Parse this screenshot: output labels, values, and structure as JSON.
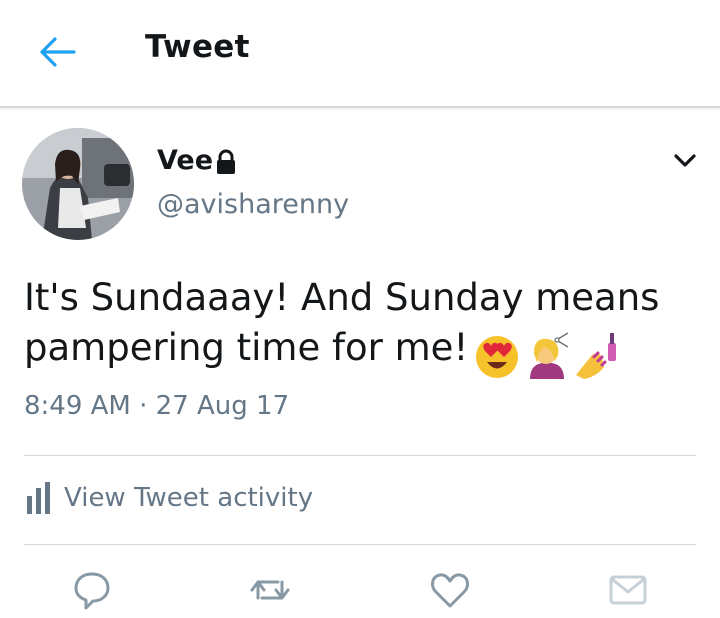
{
  "header": {
    "title": "Tweet"
  },
  "author": {
    "display_name": "Vee",
    "handle": "@avisharenny"
  },
  "tweet": {
    "text": "It's Sundaaay! And Sunday means pampering time for me!",
    "emojis": [
      "smiling-face-with-heart-eyes",
      "person-getting-haircut",
      "nail-polish"
    ],
    "timestamp": "8:49 AM · 27 Aug 17"
  },
  "activity": {
    "label": "View Tweet activity"
  },
  "colors": {
    "accent": "#1da1f2",
    "secondary_text": "#657786",
    "icon_gray": "#8899a6"
  }
}
